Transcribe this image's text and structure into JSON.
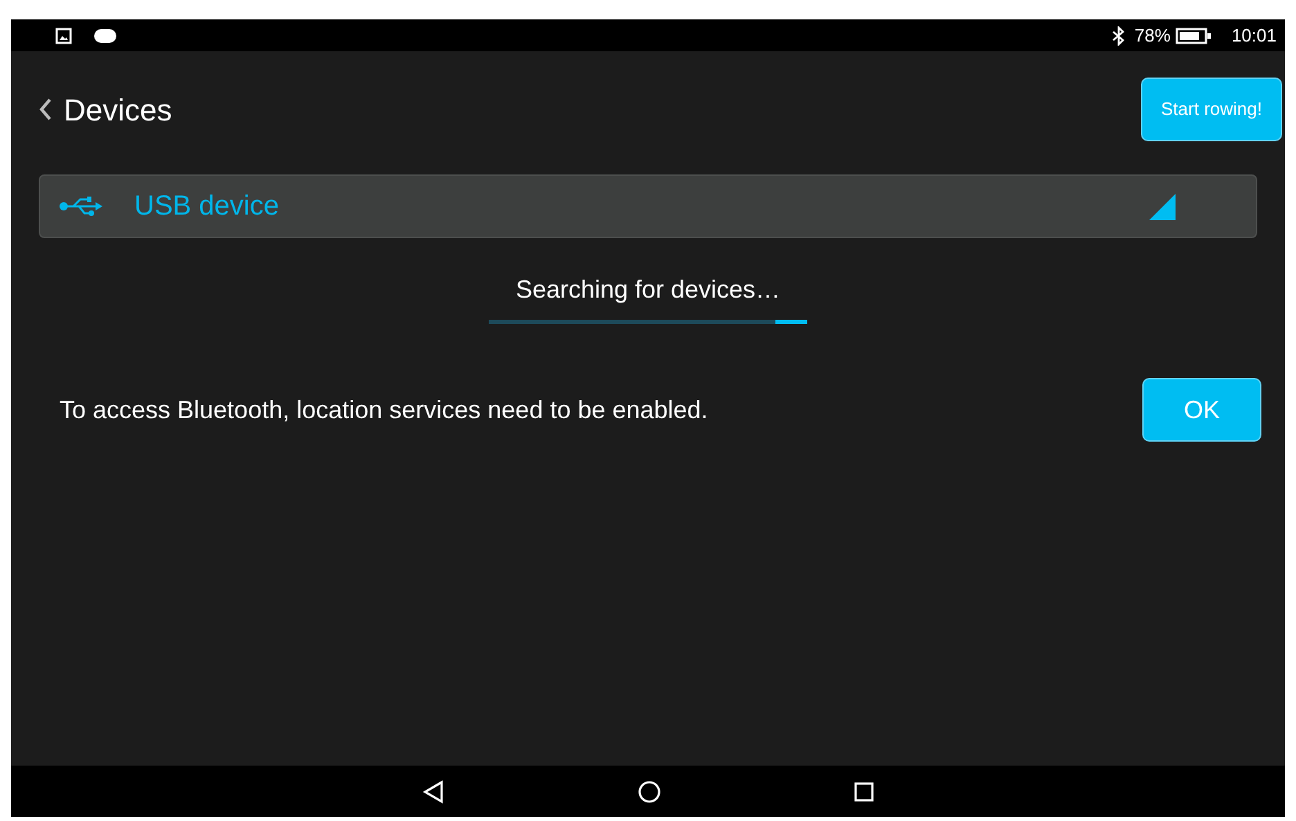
{
  "status_bar": {
    "battery": "78%",
    "time": "10:01"
  },
  "header": {
    "title": "Devices",
    "action_button": "Start rowing!"
  },
  "device_select": {
    "value": "USB device"
  },
  "search_status": {
    "text": "Searching for devices…",
    "progress": {
      "level": 0.1
    }
  },
  "notice": {
    "message": "To access Bluetooth, location services need to be enabled.",
    "button": "OK"
  }
}
